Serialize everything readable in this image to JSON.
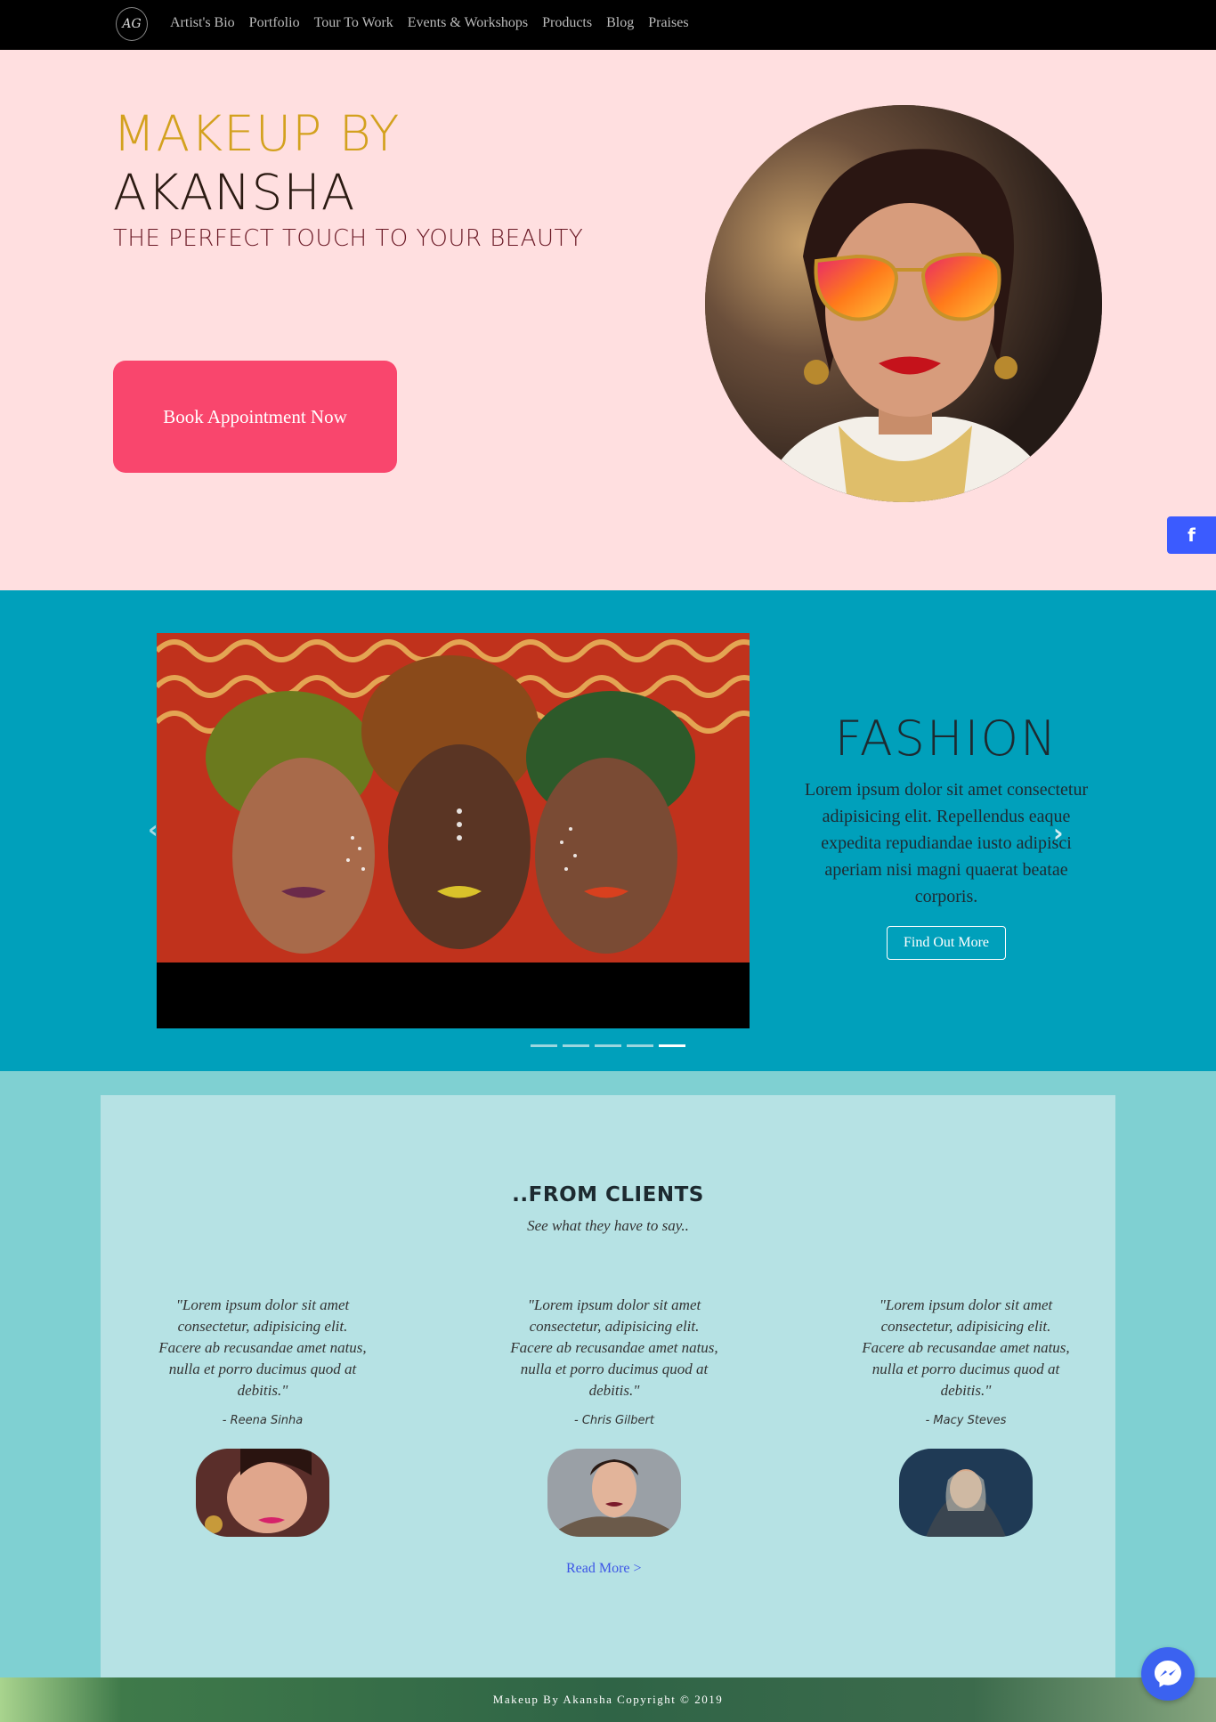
{
  "nav": {
    "logo_text": "AG",
    "links": [
      "Artist's Bio",
      "Portfolio",
      "Tour To Work",
      "Events & Workshops",
      "Products",
      "Blog",
      "Praises"
    ]
  },
  "hero": {
    "title_line1": "MAKEUP BY",
    "title_line2": "AKANSHA",
    "subtitle": "THE PERFECT TOUCH TO YOUR BEAUTY",
    "cta_label": "Book Appointment Now"
  },
  "social": {
    "facebook_icon": "f",
    "instagram_icon": "◎",
    "phone_icon": "✆",
    "email_icon": "✉"
  },
  "carousel": {
    "title": "FASHION",
    "text": "Lorem ipsum dolor sit amet consectetur adipisicing elit. Repellendus eaque expedita repudiandae iusto adipisci aperiam nisi magni quaerat beatae corporis.",
    "button_label": "Find Out More",
    "prev_icon": "‹",
    "next_icon": "›",
    "slide_count": 5,
    "active_index": 4
  },
  "testimonials": {
    "title": "..FROM CLIENTS",
    "subtitle": "See what they have to say..",
    "items": [
      {
        "quote": "\"Lorem ipsum dolor sit amet consectetur, adipisicing elit. Facere ab recusandae amet natus, nulla et porro ducimus quod at debitis.\"",
        "author": "- Reena Sinha"
      },
      {
        "quote": "\"Lorem ipsum dolor sit amet consectetur, adipisicing elit. Facere ab recusandae amet natus, nulla et porro ducimus quod at debitis.\"",
        "author": "- Chris Gilbert"
      },
      {
        "quote": "\"Lorem ipsum dolor sit amet consectetur, adipisicing elit. Facere ab recusandae amet natus, nulla et porro ducimus quod at debitis.\"",
        "author": "- Macy Steves"
      }
    ],
    "read_more": "Read More >"
  },
  "footer": {
    "text": "Makeup By Akansha Copyright © 2019"
  },
  "colors": {
    "nav_bg": "#000000",
    "hero_bg": "#ffdfe0",
    "accent_gold": "#d3a11e",
    "cta": "#f9466d",
    "carousel_bg": "#00a0bb",
    "testimonial_bg": "#7fd0d2",
    "testimonial_panel": "#b6e2e4",
    "link": "#3c55e6"
  }
}
